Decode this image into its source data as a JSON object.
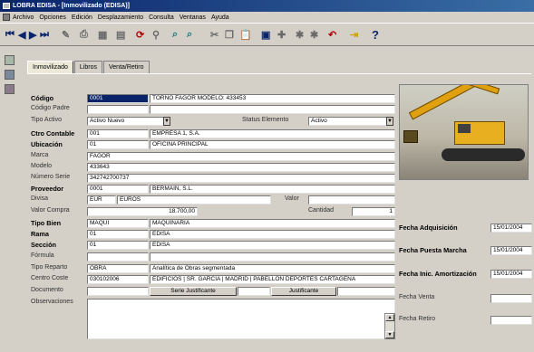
{
  "window": {
    "title": "LOBRA EDISA - [Inmovilizado (EDISA)]"
  },
  "menu": [
    "Archivo",
    "Opciones",
    "Edición",
    "Desplazamiento",
    "Consulta",
    "Ventanas",
    "Ayuda"
  ],
  "tabs": [
    "Inmovilizado",
    "Libros",
    "Venta/Retiro"
  ],
  "labels": {
    "codigo": "Código",
    "codigo_padre": "Código Padre",
    "tipo_activo": "Tipo Activo",
    "status_elemento": "Status Elemento",
    "ctro_contable": "Ctro Contable",
    "ubicacion": "Ubicación",
    "marca": "Marca",
    "modelo": "Modelo",
    "numero_serie": "Número Serie",
    "proveedor": "Proveedor",
    "divisa": "Divisa",
    "valor": "Valor",
    "valor_compra": "Valor Compra",
    "cantidad": "Cantidad",
    "tipo_bien": "Tipo Bien",
    "rama": "Rama",
    "seccion": "Sección",
    "formula": "Fórmula",
    "tipo_reparto": "Tipo Reparto",
    "centro_coste": "Centro Coste",
    "documento": "Documento",
    "observaciones": "Observaciones",
    "fecha_adquisicion": "Fecha Adquisición",
    "fecha_puesta_marcha": "Fecha Puesta Marcha",
    "fecha_inic_amortizacion": "Fecha Inic. Amortización",
    "fecha_venta": "Fecha Venta",
    "fecha_retiro": "Fecha Retiro"
  },
  "values": {
    "codigo": "0001",
    "codigo_desc": "TORNO FAGOR MODELO: 433453",
    "tipo_activo": "Activo Nuevo",
    "status_elemento": "Activo",
    "ctro_contable": "001",
    "ctro_contable_desc": "EMPRESA 1, S.A.",
    "ubicacion": "01",
    "ubicacion_desc": "OFICINA PRINCIPAL",
    "marca": "FAGOR",
    "modelo": "433643",
    "numero_serie": "342742700737",
    "proveedor": "0001",
    "proveedor_desc": "BERMAIN, S.L.",
    "divisa": "EUR",
    "divisa_desc": "EUROS",
    "valor_compra": "18.700,00",
    "cantidad": "1",
    "tipo_bien": "MAQUI",
    "tipo_bien_desc": "MAQUINARIA",
    "rama": "01",
    "rama_desc": "EDISA",
    "seccion": "01",
    "seccion_desc": "EDISA",
    "tipo_reparto": "OBRA",
    "tipo_reparto_desc": "Analítica de Obras segmentada",
    "centro_coste": "030102006",
    "centro_coste_desc": "EDIFICIOS | SR. GARCIA | MADRID | PABELLON DEPORTES CARTAGENA",
    "fecha_adquisicion": "15/01/2004",
    "fecha_puesta_marcha": "15/01/2004",
    "fecha_inic_amortizacion": "15/01/2004"
  },
  "buttons": {
    "serie_justificante": "Serie Justificante",
    "justificante": "Justificante"
  }
}
